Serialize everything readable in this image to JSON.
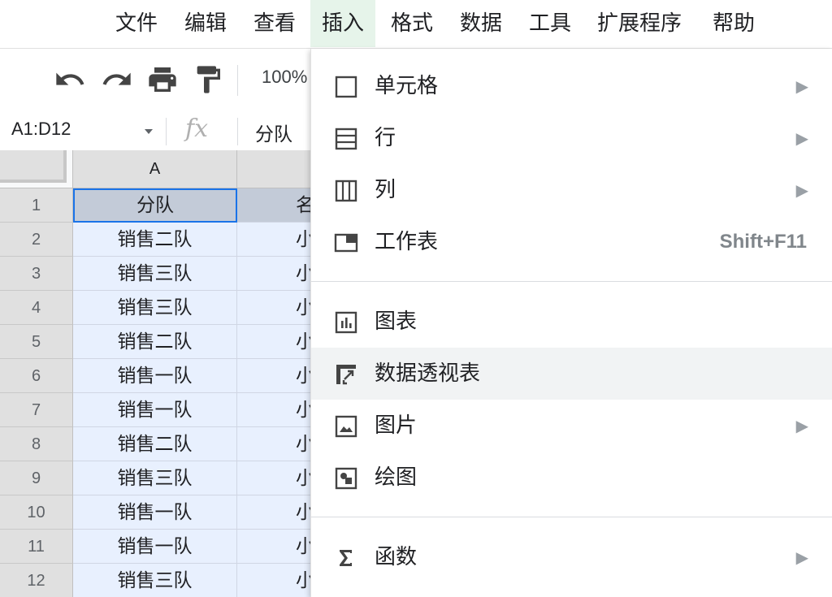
{
  "menubar": {
    "items": [
      "文件",
      "编辑",
      "查看",
      "插入",
      "格式",
      "数据",
      "工具",
      "扩展程序",
      "帮助"
    ],
    "active_index": 3
  },
  "toolbar": {
    "icons": [
      "undo-icon",
      "redo-icon",
      "print-icon",
      "paint-format-icon"
    ],
    "zoom": "100%"
  },
  "formula_bar": {
    "name_box": "A1:D12",
    "fx_label": "fx",
    "value": "分队"
  },
  "grid": {
    "columns": [
      "A"
    ],
    "rows": [
      {
        "num": "1",
        "a": "分队",
        "b": "名"
      },
      {
        "num": "2",
        "a": "销售二队",
        "b": "小"
      },
      {
        "num": "3",
        "a": "销售三队",
        "b": "小"
      },
      {
        "num": "4",
        "a": "销售三队",
        "b": "小"
      },
      {
        "num": "5",
        "a": "销售二队",
        "b": "小"
      },
      {
        "num": "6",
        "a": "销售一队",
        "b": "小"
      },
      {
        "num": "7",
        "a": "销售一队",
        "b": "小"
      },
      {
        "num": "8",
        "a": "销售二队",
        "b": "小"
      },
      {
        "num": "9",
        "a": "销售三队",
        "b": "小"
      },
      {
        "num": "10",
        "a": "销售一队",
        "b": "小"
      },
      {
        "num": "11",
        "a": "销售一队",
        "b": "小"
      },
      {
        "num": "12",
        "a": "销售三队",
        "b": "小"
      }
    ]
  },
  "insert_menu": {
    "items": [
      {
        "label": "单元格",
        "icon": "cell-icon",
        "submenu": "▶"
      },
      {
        "label": "行",
        "icon": "rows-icon",
        "submenu": "▶"
      },
      {
        "label": "列",
        "icon": "columns-icon",
        "submenu": "▶"
      },
      {
        "label": "工作表",
        "icon": "sheet-icon",
        "shortcut": "Shift+F11"
      },
      {
        "label": "图表",
        "icon": "chart-icon"
      },
      {
        "label": "数据透视表",
        "icon": "pivot-table-icon",
        "hovered": true
      },
      {
        "label": "图片",
        "icon": "image-icon",
        "submenu": "▶"
      },
      {
        "label": "绘图",
        "icon": "drawing-icon"
      },
      {
        "label": "函数",
        "icon": "sigma-icon",
        "submenu": "▶"
      }
    ]
  }
}
